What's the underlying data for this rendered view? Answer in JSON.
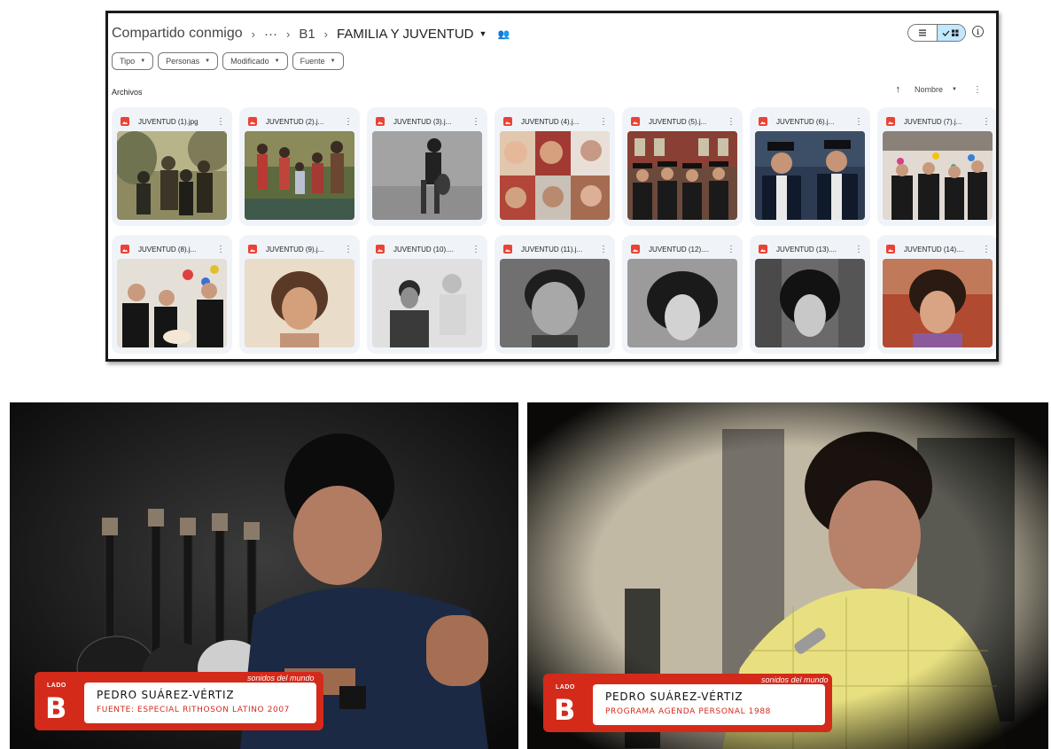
{
  "drive": {
    "breadcrumb": {
      "root": "Compartido conmigo",
      "ellipsis": "···",
      "folder": "B1",
      "current": "FAMILIA Y JUVENTUD"
    },
    "filters": [
      "Tipo",
      "Personas",
      "Modificado",
      "Fuente"
    ],
    "section_label": "Archivos",
    "sort_label": "Nombre",
    "files": [
      "JUVENTUD (1).jpg",
      "JUVENTUD (2).j...",
      "JUVENTUD (3).j...",
      "JUVENTUD (4).j...",
      "JUVENTUD (5).j...",
      "JUVENTUD (6).j...",
      "JUVENTUD (7).j...",
      "JUVENTUD (8).j...",
      "JUVENTUD (9).j...",
      "JUVENTUD (10)....",
      "JUVENTUD (11).j...",
      "JUVENTUD (12)....",
      "JUVENTUD (13)....",
      "JUVENTUD (14)...."
    ],
    "colors": {
      "chip_selected": "#c2e7ff",
      "card_bg": "#f0f4f9",
      "image_icon": "#ea4335"
    }
  },
  "videos": [
    {
      "lado": "LADO",
      "letter": "B",
      "tag": "sonidos del mundo",
      "name": "PEDRO SUÁREZ-VÉRTIZ",
      "source": "FUENTE: ESPECIAL RITHOSON LATINO 2007"
    },
    {
      "lado": "LADO",
      "letter": "B",
      "tag": "sonidos del mundo",
      "name": "PEDRO SUÁREZ-VÉRTIZ",
      "source": "PROGRAMA AGENDA PERSONAL 1988"
    }
  ],
  "overlay_color": "#d42a1a"
}
